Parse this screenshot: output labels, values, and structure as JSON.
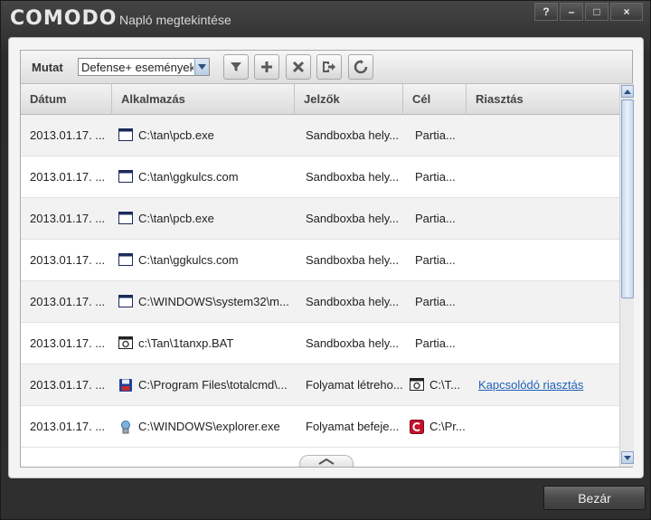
{
  "window": {
    "logo": "COMODO",
    "title": "Napló megtekintése",
    "btn_help": "?",
    "btn_min": "–",
    "btn_max": "□",
    "btn_close": "×"
  },
  "toolbar": {
    "filter_label": "Mutat",
    "filter_value": "Defense+ események",
    "buttons": [
      "filter-icon",
      "add-icon",
      "delete-icon",
      "export-icon",
      "refresh-icon"
    ]
  },
  "table": {
    "columns": [
      "Dátum",
      "Alkalmazás",
      "Jelzők",
      "Cél",
      "Riasztás"
    ],
    "rows": [
      {
        "date": "2013.01.17. ...",
        "app_icon": "window-icon",
        "app": "C:\\tan\\pcb.exe",
        "flags": "Sandboxba hely...",
        "target_icon": "",
        "target": "Partia...",
        "alert": ""
      },
      {
        "date": "2013.01.17. ...",
        "app_icon": "window-icon",
        "app": "C:\\tan\\ggkulcs.com",
        "flags": "Sandboxba hely...",
        "target_icon": "",
        "target": "Partia...",
        "alert": ""
      },
      {
        "date": "2013.01.17. ...",
        "app_icon": "window-icon",
        "app": "C:\\tan\\pcb.exe",
        "flags": "Sandboxba hely...",
        "target_icon": "",
        "target": "Partia...",
        "alert": ""
      },
      {
        "date": "2013.01.17. ...",
        "app_icon": "window-icon",
        "app": "C:\\tan\\ggkulcs.com",
        "flags": "Sandboxba hely...",
        "target_icon": "",
        "target": "Partia...",
        "alert": ""
      },
      {
        "date": "2013.01.17. ...",
        "app_icon": "window-icon",
        "app": "C:\\WINDOWS\\system32\\m...",
        "flags": "Sandboxba hely...",
        "target_icon": "",
        "target": "Partia...",
        "alert": ""
      },
      {
        "date": "2013.01.17. ...",
        "app_icon": "batch-icon",
        "app": "c:\\Tan\\1tanxp.BAT",
        "flags": "Sandboxba hely...",
        "target_icon": "",
        "target": "Partia...",
        "alert": ""
      },
      {
        "date": "2013.01.17. ...",
        "app_icon": "floppy-icon",
        "app": "C:\\Program Files\\totalcmd\\...",
        "flags": "Folyamat létreho...",
        "target_icon": "batch-icon",
        "target": "C:\\T...",
        "alert": "Kapcsolódó riasztás"
      },
      {
        "date": "2013.01.17. ...",
        "app_icon": "explorer-icon",
        "app": "C:\\WINDOWS\\explorer.exe",
        "flags": "Folyamat befeje...",
        "target_icon": "comodo-icon",
        "target": "C:\\Pr...",
        "alert": ""
      }
    ]
  },
  "footer": {
    "close_label": "Bezár"
  },
  "colors": {
    "link": "#1f5fb8",
    "chrome": "#2f2f2f",
    "comodo_red": "#c8102e"
  }
}
